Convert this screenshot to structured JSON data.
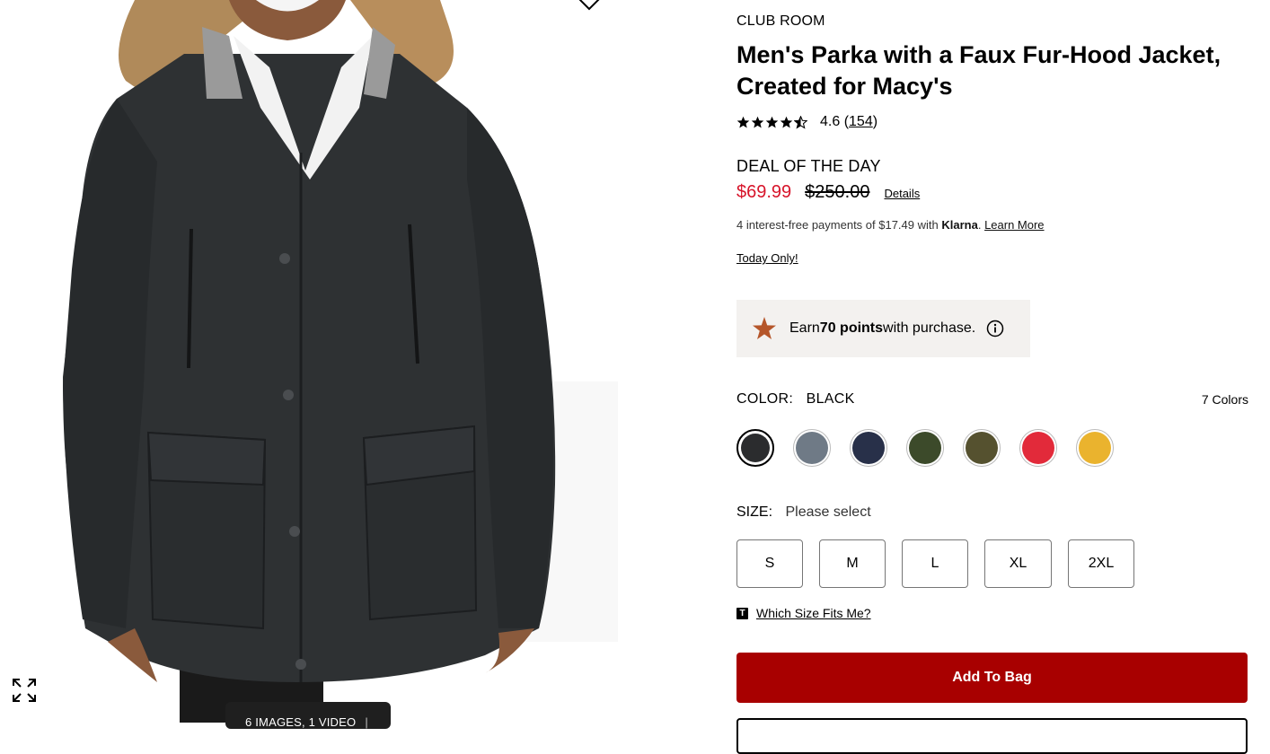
{
  "gallery": {
    "media_count": "6 IMAGES, 1 VIDEO",
    "wishlist_icon": "heart-icon",
    "expand_icon": "expand-icon"
  },
  "product": {
    "brand": "CLUB ROOM",
    "title": "Men's Parka with a Faux Fur-Hood Jacket, Created for Macy's",
    "rating": {
      "value": "4.6",
      "count": "154",
      "stars": 4.5,
      "open": "(",
      "close": ")"
    },
    "deal_label": "DEAL OF THE DAY",
    "price": {
      "sale": "$69.99",
      "original": "$250.00",
      "details_link": "Details",
      "sale_color": "#d7142a"
    },
    "klarna": {
      "prefix": "4 interest-free payments of $17.49 with ",
      "brand": "Klarna",
      "suffix": ". ",
      "learn_more": "Learn More"
    },
    "today_only": "Today Only!",
    "points": {
      "earn": "Earn ",
      "amount": "70 points",
      "suffix": " with purchase.",
      "star_color": "#b5562a"
    },
    "color": {
      "label": "COLOR:",
      "selected": "BLACK",
      "count": "7 Colors",
      "swatches": [
        {
          "name": "Black",
          "hex": "#2b2c2e",
          "selected": true
        },
        {
          "name": "Grey",
          "hex": "#6f7a86"
        },
        {
          "name": "Navy",
          "hex": "#283049"
        },
        {
          "name": "Olive",
          "hex": "#3c4a2a"
        },
        {
          "name": "Camo",
          "hex": "#55512f"
        },
        {
          "name": "Red",
          "hex": "#e22a3a"
        },
        {
          "name": "Yellow",
          "hex": "#eab32e"
        }
      ]
    },
    "size": {
      "label": "SIZE:",
      "prompt": "Please select",
      "options": [
        "S",
        "M",
        "L",
        "XL",
        "2XL"
      ],
      "fit_link": "Which Size Fits Me?"
    },
    "add_to_bag": "Add To Bag",
    "accent": "#a80000"
  }
}
